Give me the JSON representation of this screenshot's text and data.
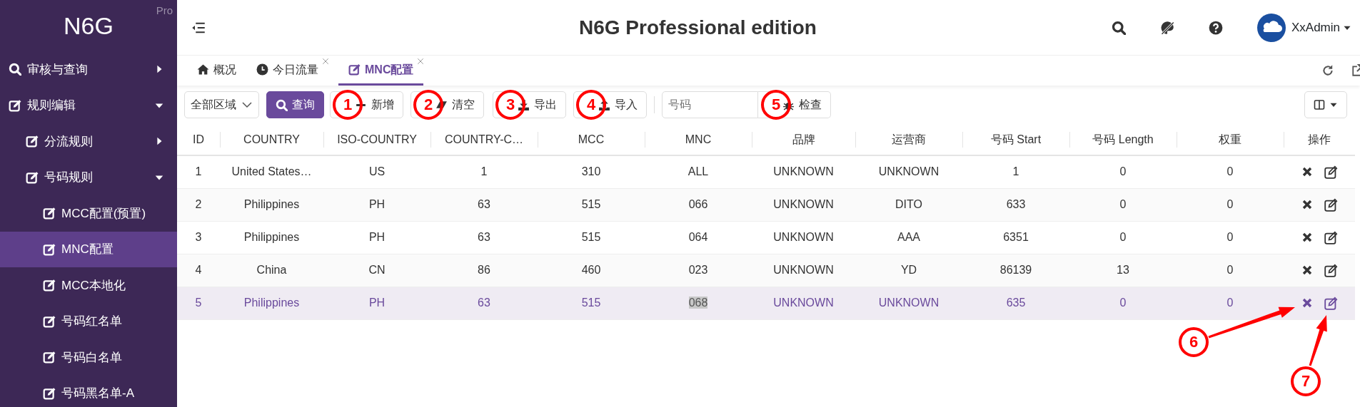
{
  "app": {
    "logo": "N6G",
    "edition_badge": "Pro",
    "title": "N6G Professional edition",
    "user": "XxAdmin"
  },
  "sidebar": {
    "items": [
      {
        "label": "审核与查询",
        "expanded": false,
        "selected": false
      },
      {
        "label": "规则编辑",
        "expanded": true,
        "selected": false,
        "children": [
          {
            "label": "分流规则",
            "expanded": false,
            "selected": false
          },
          {
            "label": "号码规则",
            "expanded": true,
            "selected": false,
            "children": [
              {
                "label": "MCC配置(预置)",
                "selected": false
              },
              {
                "label": "MNC配置",
                "selected": true
              },
              {
                "label": "MCC本地化",
                "selected": false
              },
              {
                "label": "号码红名单",
                "selected": false
              },
              {
                "label": "号码白名单",
                "selected": false
              },
              {
                "label": "号码黑名单-A",
                "selected": false
              }
            ]
          }
        ]
      }
    ]
  },
  "tabs": [
    {
      "label": "概况",
      "closable": false,
      "selected": false
    },
    {
      "label": "今日流量",
      "closable": true,
      "selected": false
    },
    {
      "label": "MNC配置",
      "closable": true,
      "selected": true
    }
  ],
  "toolbar": {
    "region_select": {
      "value": "全部区域"
    },
    "buttons": [
      {
        "label": "查询",
        "kind": "primary"
      },
      {
        "label": "新增",
        "kind": "plain",
        "annotation": "1"
      },
      {
        "label": "清空",
        "kind": "plain",
        "annotation": "2"
      },
      {
        "label": "导出",
        "kind": "plain",
        "annotation": "3"
      },
      {
        "label": "导入",
        "kind": "plain",
        "annotation": "4"
      }
    ],
    "number_field": {
      "placeholder": "号码"
    },
    "check_button": {
      "label": "检查",
      "annotation": "5"
    }
  },
  "table": {
    "columns": [
      "ID",
      "COUNTRY",
      "ISO-COUNTRY",
      "COUNTRY-C…",
      "MCC",
      "MNC",
      "品牌",
      "运营商",
      "号码 Start",
      "号码 Length",
      "权重",
      "操作"
    ],
    "rows": [
      {
        "cells": [
          "1",
          "United States…",
          "US",
          "1",
          "310",
          "ALL",
          "UNKNOWN",
          "UNKNOWN",
          "1",
          "0",
          "0"
        ],
        "selected": false,
        "mnc_text_selected": false
      },
      {
        "cells": [
          "2",
          "Philippines",
          "PH",
          "63",
          "515",
          "066",
          "UNKNOWN",
          "DITO",
          "633",
          "0",
          "0"
        ],
        "selected": false,
        "mnc_text_selected": false
      },
      {
        "cells": [
          "3",
          "Philippines",
          "PH",
          "63",
          "515",
          "064",
          "UNKNOWN",
          "AAA",
          "6351",
          "0",
          "0"
        ],
        "selected": false,
        "mnc_text_selected": false
      },
      {
        "cells": [
          "4",
          "China",
          "CN",
          "86",
          "460",
          "023",
          "UNKNOWN",
          "YD",
          "86139",
          "13",
          "0"
        ],
        "selected": false,
        "mnc_text_selected": false
      },
      {
        "cells": [
          "5",
          "Philippines",
          "PH",
          "63",
          "515",
          "068",
          "UNKNOWN",
          "UNKNOWN",
          "635",
          "0",
          "0"
        ],
        "selected": true,
        "mnc_text_selected": true
      }
    ]
  },
  "callouts": [
    {
      "label": "6"
    },
    {
      "label": "7"
    }
  ]
}
